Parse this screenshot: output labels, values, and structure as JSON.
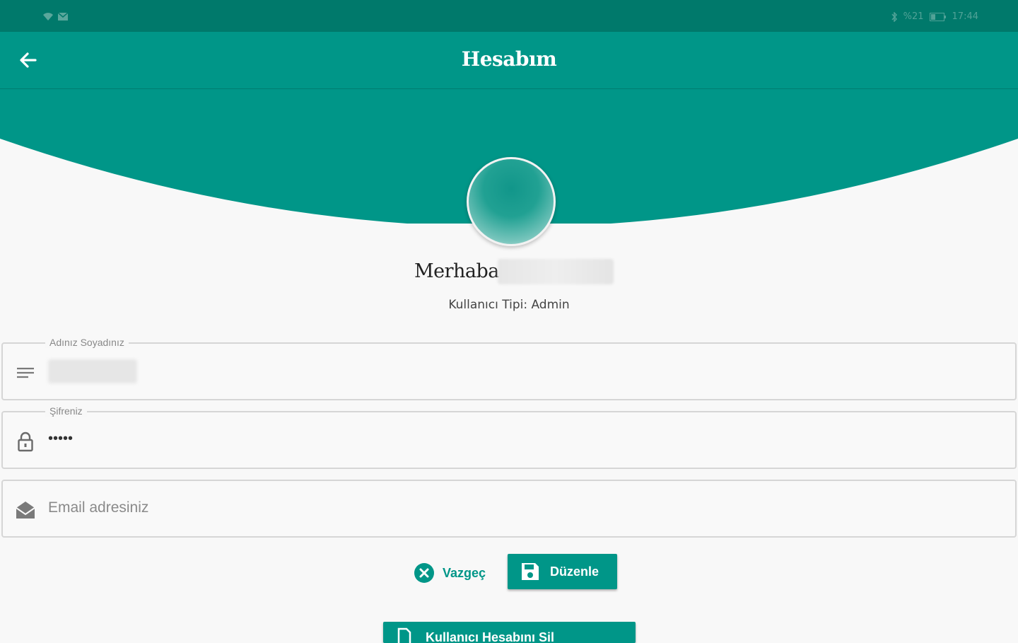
{
  "app": {
    "title": "Hesabım",
    "accent_color": "#009688",
    "status_bar_color": "#00796b"
  },
  "status_bar": {
    "icons_left": [
      "wifi-icon",
      "mail-icon"
    ],
    "battery_text": "%21",
    "time": "17:44"
  },
  "profile": {
    "greeting": "Merhaba",
    "user_type": "Kullanıcı Tipi: Admin"
  },
  "form": {
    "name_label": "Adınız Soyadınız",
    "password_label": "Şifreniz",
    "password_value": "•••••",
    "email_placeholder": "Email adresiniz"
  },
  "actions": {
    "cancel_label": "Vazgeç",
    "edit_label": "Düzenle",
    "bottom_button_label": "Kullanıcı Hesabını Sil"
  }
}
